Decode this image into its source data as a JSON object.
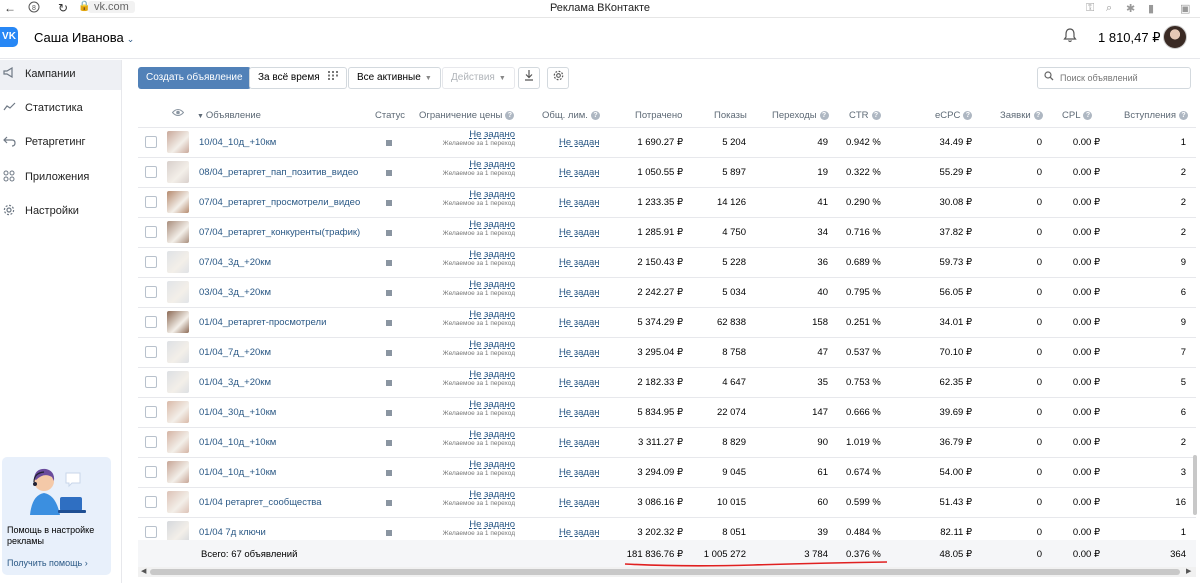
{
  "browser": {
    "back": "←",
    "forward_icon": "circle-icon",
    "reload": "↻",
    "address": "vk.com",
    "title": "Реклама ВКонтакте"
  },
  "header": {
    "logo": "VK",
    "user_name": "Саша Иванова",
    "balance": "1 810,47 ₽"
  },
  "sidebar": {
    "items": [
      {
        "label": "Кампании",
        "icon": "megaphone-icon",
        "active": true
      },
      {
        "label": "Статистика",
        "icon": "chart-icon",
        "active": false
      },
      {
        "label": "Ретаргетинг",
        "icon": "retarget-icon",
        "active": false
      },
      {
        "label": "Приложения",
        "icon": "apps-icon",
        "active": false
      },
      {
        "label": "Настройки",
        "icon": "gear-icon",
        "active": false
      }
    ],
    "help": {
      "text": "Помощь в настройке рекламы",
      "link": "Получить помощь"
    }
  },
  "toolbar": {
    "create": "Создать объявление",
    "period": "За всё время",
    "filter": "Все активные",
    "actions": "Действия",
    "search_placeholder": "Поиск объявлений"
  },
  "table": {
    "headers": {
      "ad": "Объявление",
      "status": "Статус",
      "price_limit": "Ограничение цены",
      "total_limit": "Общ. лим.",
      "spent": "Потрачено",
      "impressions": "Показы",
      "clicks": "Переходы",
      "ctr": "CTR",
      "ecpc": "eCPC",
      "leads": "Заявки",
      "cpl": "CPL",
      "joins": "Вступления"
    },
    "price_limit_main": "Не задано",
    "price_limit_sub": "Желаемое за 1 переход",
    "total_limit_value": "Не задан",
    "rows": [
      {
        "name": "10/04_10д_+10км",
        "spent": "1 690.27 ₽",
        "impressions": "5 204",
        "clicks": "49",
        "ctr": "0.942 %",
        "ecpc": "34.49 ₽",
        "leads": "0",
        "cpl": "0.00 ₽",
        "joins": "1",
        "thumb": "#c9a89a"
      },
      {
        "name": "08/04_ретаргет_пап_позитив_видео",
        "spent": "1 050.55 ₽",
        "impressions": "5 897",
        "clicks": "19",
        "ctr": "0.322 %",
        "ecpc": "55.29 ₽",
        "leads": "0",
        "cpl": "0.00 ₽",
        "joins": "2",
        "thumb": "#d8cfcb"
      },
      {
        "name": "07/04_ретаргет_просмотрели_видео",
        "spent": "1 233.35 ₽",
        "impressions": "14 126",
        "clicks": "41",
        "ctr": "0.290 %",
        "ecpc": "30.08 ₽",
        "leads": "0",
        "cpl": "0.00 ₽",
        "joins": "2",
        "thumb": "#b58a6e"
      },
      {
        "name": "07/04_ретаргет_конкуренты(трафик)",
        "spent": "1 285.91 ₽",
        "impressions": "4 750",
        "clicks": "34",
        "ctr": "0.716 %",
        "ecpc": "37.82 ₽",
        "leads": "0",
        "cpl": "0.00 ₽",
        "joins": "2",
        "thumb": "#a88d7c"
      },
      {
        "name": "07/04_3д_+20км",
        "spent": "2 150.43 ₽",
        "impressions": "5 228",
        "clicks": "36",
        "ctr": "0.689 %",
        "ecpc": "59.73 ₽",
        "leads": "0",
        "cpl": "0.00 ₽",
        "joins": "9",
        "thumb": "#dfe2e6"
      },
      {
        "name": "03/04_3д_+20км",
        "spent": "2 242.27 ₽",
        "impressions": "5 034",
        "clicks": "40",
        "ctr": "0.795 %",
        "ecpc": "56.05 ₽",
        "leads": "0",
        "cpl": "0.00 ₽",
        "joins": "6",
        "thumb": "#e1e4e8"
      },
      {
        "name": "01/04_ретаргет-просмотрели",
        "spent": "5 374.29 ₽",
        "impressions": "62 838",
        "clicks": "158",
        "ctr": "0.251 %",
        "ecpc": "34.01 ₽",
        "leads": "0",
        "cpl": "0.00 ₽",
        "joins": "9",
        "thumb": "#8c6a55"
      },
      {
        "name": "01/04_7д_+20км",
        "spent": "3 295.04 ₽",
        "impressions": "8 758",
        "clicks": "47",
        "ctr": "0.537 %",
        "ecpc": "70.10 ₽",
        "leads": "0",
        "cpl": "0.00 ₽",
        "joins": "7",
        "thumb": "#dde0e4"
      },
      {
        "name": "01/04_3д_+20км",
        "spent": "2 182.33 ₽",
        "impressions": "4 647",
        "clicks": "35",
        "ctr": "0.753 %",
        "ecpc": "62.35 ₽",
        "leads": "0",
        "cpl": "0.00 ₽",
        "joins": "5",
        "thumb": "#dcdfe3"
      },
      {
        "name": "01/04_30д_+10км",
        "spent": "5 834.95 ₽",
        "impressions": "22 074",
        "clicks": "147",
        "ctr": "0.666 %",
        "ecpc": "39.69 ₽",
        "leads": "0",
        "cpl": "0.00 ₽",
        "joins": "6",
        "thumb": "#d9b9a8"
      },
      {
        "name": "01/04_10д_+10км",
        "spent": "3 311.27 ₽",
        "impressions": "8 829",
        "clicks": "90",
        "ctr": "1.019 %",
        "ecpc": "36.79 ₽",
        "leads": "0",
        "cpl": "0.00 ₽",
        "joins": "2",
        "thumb": "#d4b3a3"
      },
      {
        "name": "01/04_10д_+10км",
        "spent": "3 294.09 ₽",
        "impressions": "9 045",
        "clicks": "61",
        "ctr": "0.674 %",
        "ecpc": "54.00 ₽",
        "leads": "0",
        "cpl": "0.00 ₽",
        "joins": "3",
        "thumb": "#c7a596"
      },
      {
        "name": "01/04 ретаргет_сообщества",
        "spent": "3 086.16 ₽",
        "impressions": "10 015",
        "clicks": "60",
        "ctr": "0.599 %",
        "ecpc": "51.43 ₽",
        "leads": "0",
        "cpl": "0.00 ₽",
        "joins": "16",
        "thumb": "#dcc2b6"
      },
      {
        "name": "01/04 7д ключи",
        "spent": "3 202.32 ₽",
        "impressions": "8 051",
        "clicks": "39",
        "ctr": "0.484 %",
        "ecpc": "82.11 ₽",
        "leads": "0",
        "cpl": "0.00 ₽",
        "joins": "1",
        "thumb": "#d5d8dc"
      }
    ],
    "totals": {
      "label": "Всего: 67 объявлений",
      "spent": "181 836.76 ₽",
      "impressions": "1 005 272",
      "clicks": "3 784",
      "ctr": "0.376 %",
      "ecpc": "48.05 ₽",
      "leads": "0",
      "cpl": "0.00 ₽",
      "joins": "364"
    }
  },
  "colors": {
    "accent": "#5181b8",
    "link": "#2a5885",
    "underline": "#e02020"
  }
}
